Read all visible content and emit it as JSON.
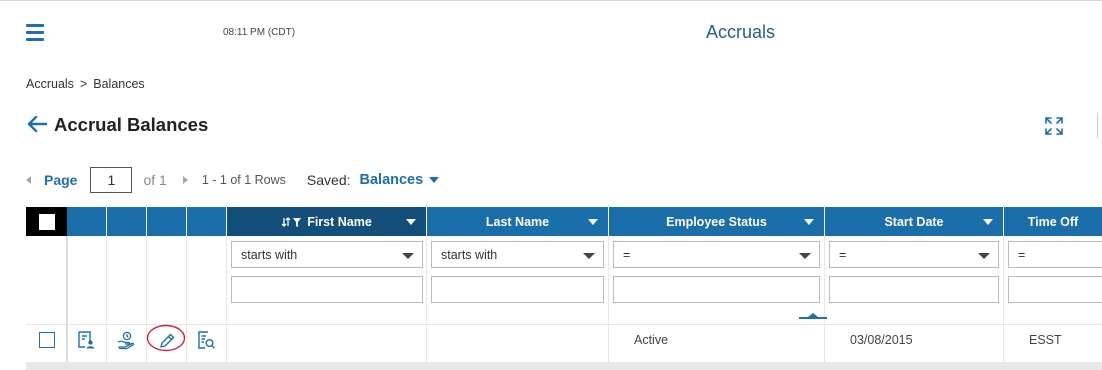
{
  "header": {
    "clock": "08:11 PM (CDT)",
    "app_title": "Accruals"
  },
  "breadcrumb": {
    "parent": "Accruals",
    "separator": ">",
    "current": "Balances"
  },
  "page": {
    "title": "Accrual Balances"
  },
  "pager": {
    "page_label": "Page",
    "page_value": "1",
    "of_label": "of 1",
    "rows_label": "1 - 1 of 1 Rows",
    "saved_label": "Saved:",
    "saved_value": "Balances"
  },
  "grid": {
    "columns": [
      {
        "label": "First Name"
      },
      {
        "label": "Last Name"
      },
      {
        "label": "Employee Status"
      },
      {
        "label": "Start Date"
      },
      {
        "label": "Time Off"
      }
    ],
    "filters": [
      {
        "operator": "starts with"
      },
      {
        "operator": "starts with"
      },
      {
        "operator": "="
      },
      {
        "operator": "="
      },
      {
        "operator": "="
      }
    ],
    "rows": [
      {
        "first_name": "",
        "last_name": "",
        "employee_status": "Active",
        "start_date": "03/08/2015",
        "time_off": "ESST"
      }
    ]
  },
  "icons": {
    "menu": "hamburger-menu-icon",
    "back": "arrow-left-icon",
    "expand": "expand-icon",
    "row_actions": [
      "employee-card-icon",
      "hand-coin-icon",
      "pencil-edit-icon",
      "document-search-icon"
    ]
  },
  "colors": {
    "accent": "#1f6fae",
    "header_bg": "#1a6ea9",
    "header_active": "#134f7a",
    "highlight_circle": "#c0283a"
  }
}
